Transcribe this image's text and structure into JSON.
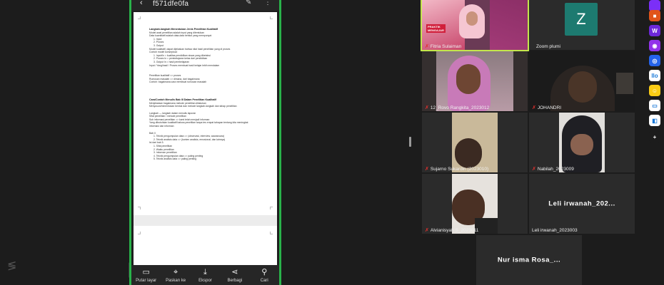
{
  "share": {
    "filename": "f571dfe0fa",
    "back_icon": "‹",
    "doc_lines_1": [
      {
        "text": "Langkah-langkah Menentukan Jenis Penelitian Kualitatif",
        "bold": true
      },
      {
        "text": "Model awal penelitian adalah input yang ditentukan"
      },
      {
        "text": "Data kuantitatif adalah data-data berikut yang mempunyai:"
      },
      {
        "text": "1.   Input",
        "indent": true
      },
      {
        "text": "2.   Proses",
        "indent": true
      },
      {
        "text": "3.   Output",
        "indent": true
      },
      {
        "text": "Model kualitatif, dapat dijelaskan bahwa nilai hasil penelitian yang di proses"
      },
      {
        "text": "Contoh model konseptual:"
      },
      {
        "text": "1.   Input/In = kualitas pendidikan siswa yang diketahui",
        "indent": true
      },
      {
        "text": "2.   Proses In = pembelajaran kelas dari pendidikan",
        "indent": true
      },
      {
        "text": "3.   Output In = hasil pembelajaran",
        "indent": true
      },
      {
        "text": "Input / Yang/hasil / Proses membuat hasil belajar lebih mendalam"
      }
    ],
    "doc_lines_2": [
      {
        "text": "Penelitian kualitatif => proses"
      },
      {
        "text": "Rumusan masalah => dimana, dari bagaimana"
      },
      {
        "text": "Contoh: bagaimana cara membuat rumusan masalah"
      }
    ],
    "doc_lines_3": [
      {
        "text": "Cara/Contoh Menulis Bab III Dalam Penelitian Kualitatif",
        "bold": true
      },
      {
        "text": "Menjelaskan bagaimana metode penelitian dilakukan"
      },
      {
        "text": "Menyusun/menentukan bentuk dan metode langkah-langkah dan tahap penelitian"
      }
    ],
    "doc_lines_4": [
      {
        "text": "Langkah — langkah dalam menulis laporan"
      },
      {
        "text": "Sifat penelitian / metode penelitian"
      },
      {
        "text": "Sub informasi penelitian => kami telah menjadi informan"
      },
      {
        "text": "Yang dibutuhkan kualitatif bahwa penelitian tanpa tes empat tahapan tentang kita meningkat"
      },
      {
        "text": "informasi dan informan"
      }
    ],
    "doc_lines_5": [
      {
        "text": "Bab II"
      },
      {
        "text": "1.   Teknik pengumpulan data => (observasi, interview, wawancara)",
        "indent": true
      },
      {
        "text": "2.   Teknik analisis data => (konten analisis, emosional, dan lainnya)",
        "indent": true
      },
      {
        "text": "Isi dari bab 3:"
      },
      {
        "text": "1.   Sifat penelitian",
        "indent": true
      },
      {
        "text": "2.   Waktu penelitian",
        "indent": true
      },
      {
        "text": "3.   Informan penelitian",
        "indent": true
      },
      {
        "text": "4.   Teknik pengumpulan data => paling penting",
        "indent": true
      },
      {
        "text": "5.   Teknik analisis data => paling penting",
        "indent": true
      }
    ],
    "toolbar": [
      {
        "icon": "▭",
        "label": "Putar layar",
        "name": "rotate-screen"
      },
      {
        "icon": "⌖",
        "label": "Paskan ke",
        "name": "fit-to"
      },
      {
        "icon": "⤓",
        "label": "Ekspor",
        "name": "export"
      },
      {
        "icon": "⋖",
        "label": "Berbagi",
        "name": "share"
      },
      {
        "icon": "⚲",
        "label": "Cari",
        "name": "search"
      }
    ]
  },
  "participants": [
    {
      "id": "p1",
      "name": "Fitria Sulaiman",
      "kind": "video",
      "active": true
    },
    {
      "id": "p2",
      "name": "Zoom plumi",
      "kind": "avatar",
      "initial": "Z"
    },
    {
      "id": "p3",
      "name": "12_Rovo Rangkita_2023012",
      "kind": "video"
    },
    {
      "id": "p4",
      "name": "JOHANDRI",
      "kind": "video"
    },
    {
      "id": "p5",
      "name": "Sujarno Sukardin (2023010)",
      "kind": "video"
    },
    {
      "id": "p6",
      "name": "Nabilah_2023009",
      "kind": "video"
    },
    {
      "id": "p7",
      "name": "Alvianisyah S_2023011",
      "kind": "video"
    },
    {
      "id": "p8",
      "name": "Leli irwanah_2023003",
      "kind": "name",
      "display": "Leli irwanah_202..."
    },
    {
      "id": "p9",
      "name": "",
      "kind": "name",
      "display": "Nur isma Rosa_..."
    }
  ],
  "apps": [
    {
      "color": "#7b2ff7",
      "glyph": ""
    },
    {
      "color": "#e1541a",
      "glyph": "■"
    },
    {
      "color": "#6d28d9",
      "glyph": "W"
    },
    {
      "color": "#9333ea",
      "glyph": "◉"
    },
    {
      "color": "#2563eb",
      "glyph": "◎"
    },
    {
      "color": "#ffffff",
      "glyph": "llo"
    },
    {
      "color": "#facc15",
      "glyph": "☺"
    },
    {
      "color": "#ffffff",
      "glyph": "▭"
    },
    {
      "color": "#ffffff",
      "glyph": "◧"
    },
    {
      "color": "#1c1c1c",
      "glyph": "+"
    }
  ]
}
